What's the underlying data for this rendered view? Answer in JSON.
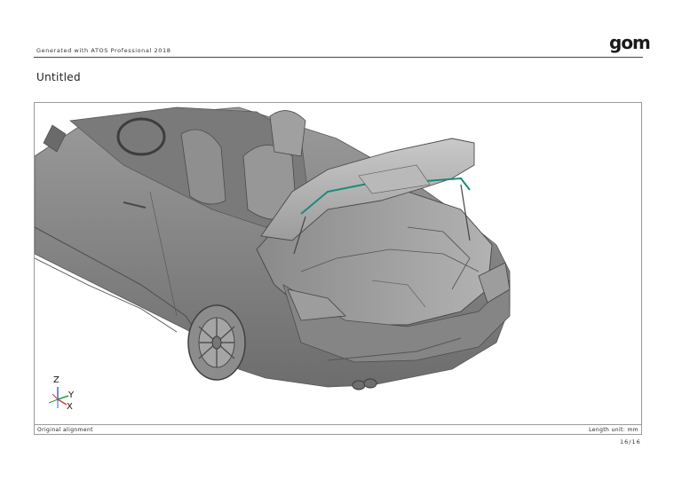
{
  "header": {
    "generator": "Generated with ATOS Professional 2018",
    "logo": "gom"
  },
  "report": {
    "title": "Untitled"
  },
  "viewport": {
    "axes": {
      "z": "Z",
      "y": "Y",
      "x": "X"
    }
  },
  "footer": {
    "alignment": "Original alignment",
    "length_unit": "Length unit: mm"
  },
  "page": {
    "number": "16/16"
  }
}
